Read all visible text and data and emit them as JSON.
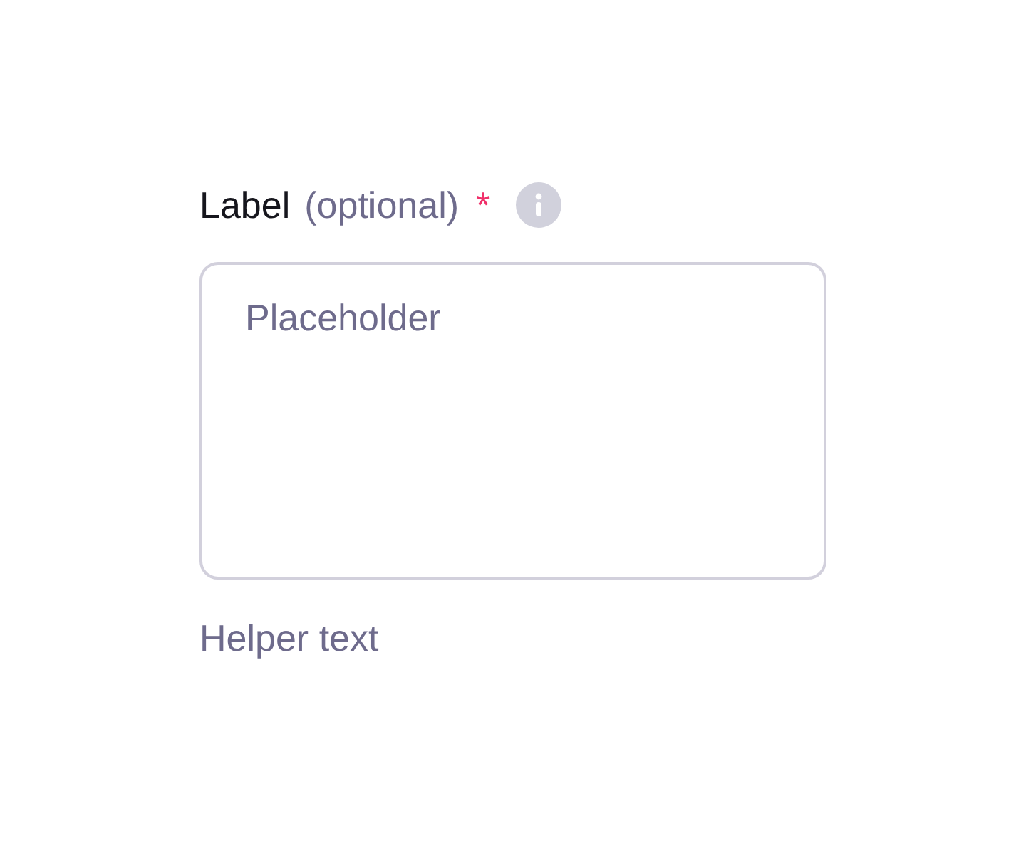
{
  "field": {
    "label": "Label",
    "optional_text": "(optional)",
    "required": true,
    "required_mark": "*",
    "info_icon": true,
    "placeholder": "Placeholder",
    "helper_text": "Helper text"
  }
}
